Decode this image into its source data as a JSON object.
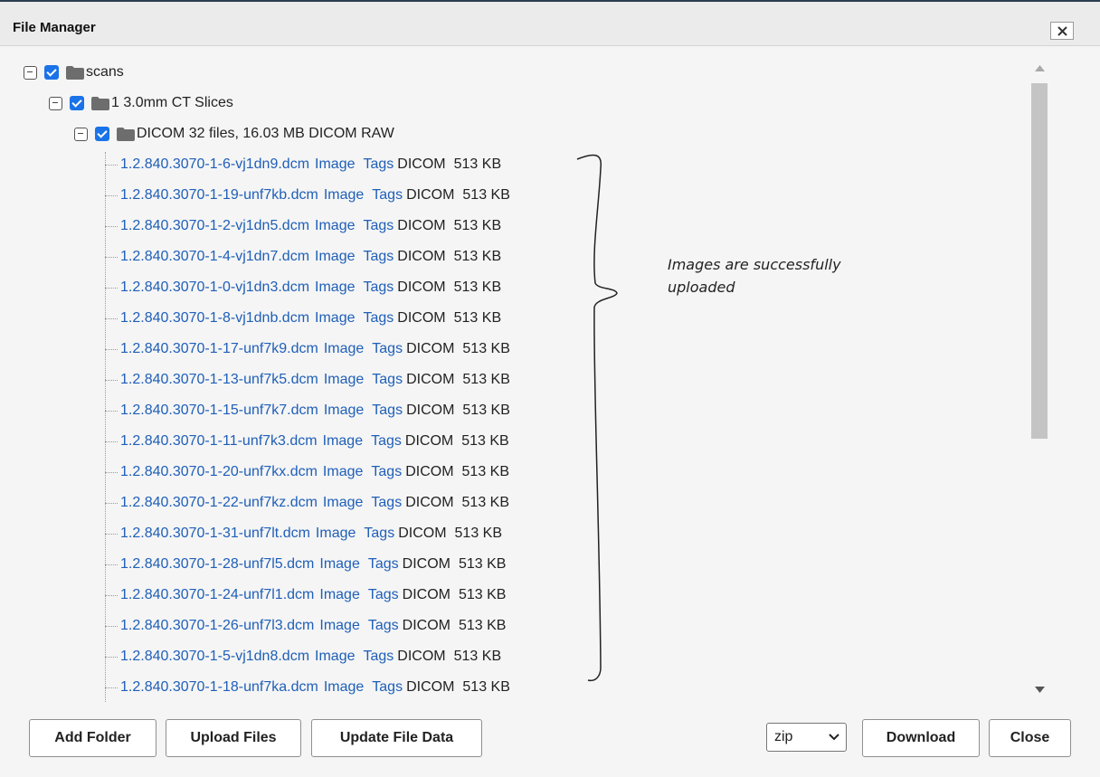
{
  "window": {
    "title": "File Manager"
  },
  "tree": {
    "root": {
      "label": "scans"
    },
    "scan": {
      "label": "1 3.0mm CT Slices"
    },
    "resource": {
      "label": "DICOM  32 files, 16.03 MB DICOM RAW"
    },
    "files": [
      {
        "name": "1.2.840.3070-1-6-vj1dn9.dcm",
        "image": "Image",
        "tags": "Tags",
        "format": "DICOM",
        "size": "513 KB"
      },
      {
        "name": "1.2.840.3070-1-19-unf7kb.dcm",
        "image": "Image",
        "tags": "Tags",
        "format": "DICOM",
        "size": "513 KB"
      },
      {
        "name": "1.2.840.3070-1-2-vj1dn5.dcm",
        "image": "Image",
        "tags": "Tags",
        "format": "DICOM",
        "size": "513 KB"
      },
      {
        "name": "1.2.840.3070-1-4-vj1dn7.dcm",
        "image": "Image",
        "tags": "Tags",
        "format": "DICOM",
        "size": "513 KB"
      },
      {
        "name": "1.2.840.3070-1-0-vj1dn3.dcm",
        "image": "Image",
        "tags": "Tags",
        "format": "DICOM",
        "size": "513 KB"
      },
      {
        "name": "1.2.840.3070-1-8-vj1dnb.dcm",
        "image": "Image",
        "tags": "Tags",
        "format": "DICOM",
        "size": "513 KB"
      },
      {
        "name": "1.2.840.3070-1-17-unf7k9.dcm",
        "image": "Image",
        "tags": "Tags",
        "format": "DICOM",
        "size": "513 KB"
      },
      {
        "name": "1.2.840.3070-1-13-unf7k5.dcm",
        "image": "Image",
        "tags": "Tags",
        "format": "DICOM",
        "size": "513 KB"
      },
      {
        "name": "1.2.840.3070-1-15-unf7k7.dcm",
        "image": "Image",
        "tags": "Tags",
        "format": "DICOM",
        "size": "513 KB"
      },
      {
        "name": "1.2.840.3070-1-11-unf7k3.dcm",
        "image": "Image",
        "tags": "Tags",
        "format": "DICOM",
        "size": "513 KB"
      },
      {
        "name": "1.2.840.3070-1-20-unf7kx.dcm",
        "image": "Image",
        "tags": "Tags",
        "format": "DICOM",
        "size": "513 KB"
      },
      {
        "name": "1.2.840.3070-1-22-unf7kz.dcm",
        "image": "Image",
        "tags": "Tags",
        "format": "DICOM",
        "size": "513 KB"
      },
      {
        "name": "1.2.840.3070-1-31-unf7lt.dcm",
        "image": "Image",
        "tags": "Tags",
        "format": "DICOM",
        "size": "513 KB"
      },
      {
        "name": "1.2.840.3070-1-28-unf7l5.dcm",
        "image": "Image",
        "tags": "Tags",
        "format": "DICOM",
        "size": "513 KB"
      },
      {
        "name": "1.2.840.3070-1-24-unf7l1.dcm",
        "image": "Image",
        "tags": "Tags",
        "format": "DICOM",
        "size": "513 KB"
      },
      {
        "name": "1.2.840.3070-1-26-unf7l3.dcm",
        "image": "Image",
        "tags": "Tags",
        "format": "DICOM",
        "size": "513 KB"
      },
      {
        "name": "1.2.840.3070-1-5-vj1dn8.dcm",
        "image": "Image",
        "tags": "Tags",
        "format": "DICOM",
        "size": "513 KB"
      },
      {
        "name": "1.2.840.3070-1-18-unf7ka.dcm",
        "image": "Image",
        "tags": "Tags",
        "format": "DICOM",
        "size": "513 KB"
      }
    ]
  },
  "annotation": {
    "line1": "Images are successfully",
    "line2": "uploaded"
  },
  "toolbar": {
    "add_folder_label": "Add Folder",
    "upload_files_label": "Upload Files",
    "update_file_data_label": "Update File Data",
    "format_selected": "zip",
    "download_label": "Download",
    "close_label": "Close"
  },
  "icons": {
    "close": "close-icon",
    "expander": "collapse-icon",
    "checkbox": "checkbox-checked-icon",
    "folder": "folder-icon",
    "scroll_up": "arrow-up-icon",
    "scroll_down": "arrow-down-icon",
    "dropdown": "chevron-down-icon"
  },
  "colors": {
    "link": "#1f5fb8",
    "checkbox": "#1a73e8",
    "scroll_thumb": "#c4c4c4"
  }
}
